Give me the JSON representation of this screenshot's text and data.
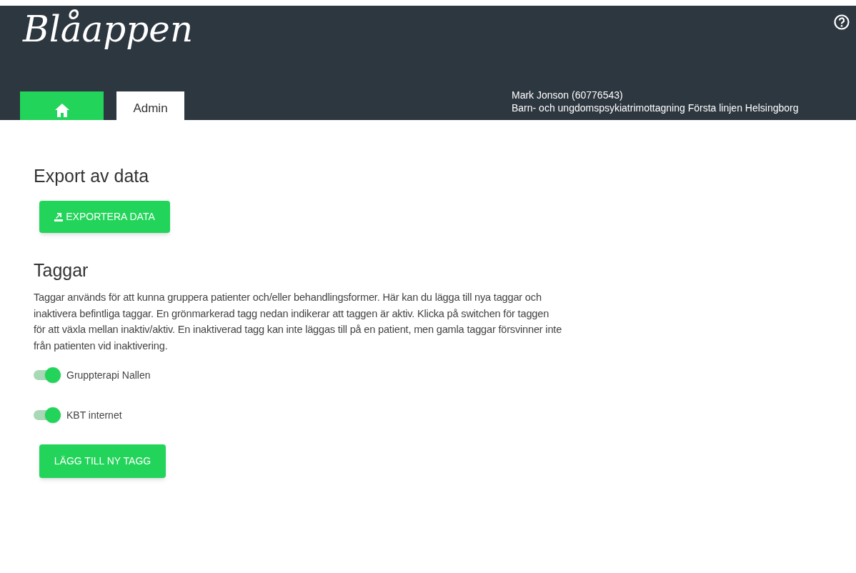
{
  "header": {
    "logo": "Blåappen",
    "tabs": [
      {
        "kind": "home",
        "selected": false
      },
      {
        "kind": "text",
        "label": "Admin",
        "selected": true
      }
    ],
    "user": {
      "name": "Mark Jonson (60776543)",
      "unit": "Barn- och ungdomspsykiatrimottagning Första linjen Helsingborg"
    }
  },
  "export": {
    "title": "Export av data",
    "button": "EXPORTERA DATA"
  },
  "tags": {
    "title": "Taggar",
    "description": "Taggar används för att kunna gruppera patienter och/eller behandlingsformer. Här kan du lägga till nya taggar och inaktivera befintliga taggar. En grönmarkerad tagg nedan indikerar att taggen är aktiv. Klicka på switchen för taggen för att växla mellan inaktiv/aktiv. En inaktiverad tagg kan inte läggas till på en patient, men gamla taggar försvinner inte från patienten vid inaktivering.",
    "items": [
      {
        "label": "Gruppterapi Nallen",
        "on": true
      },
      {
        "label": "KBT internet",
        "on": true
      }
    ],
    "add_button": "LÄGG TILL NY TAGG"
  }
}
